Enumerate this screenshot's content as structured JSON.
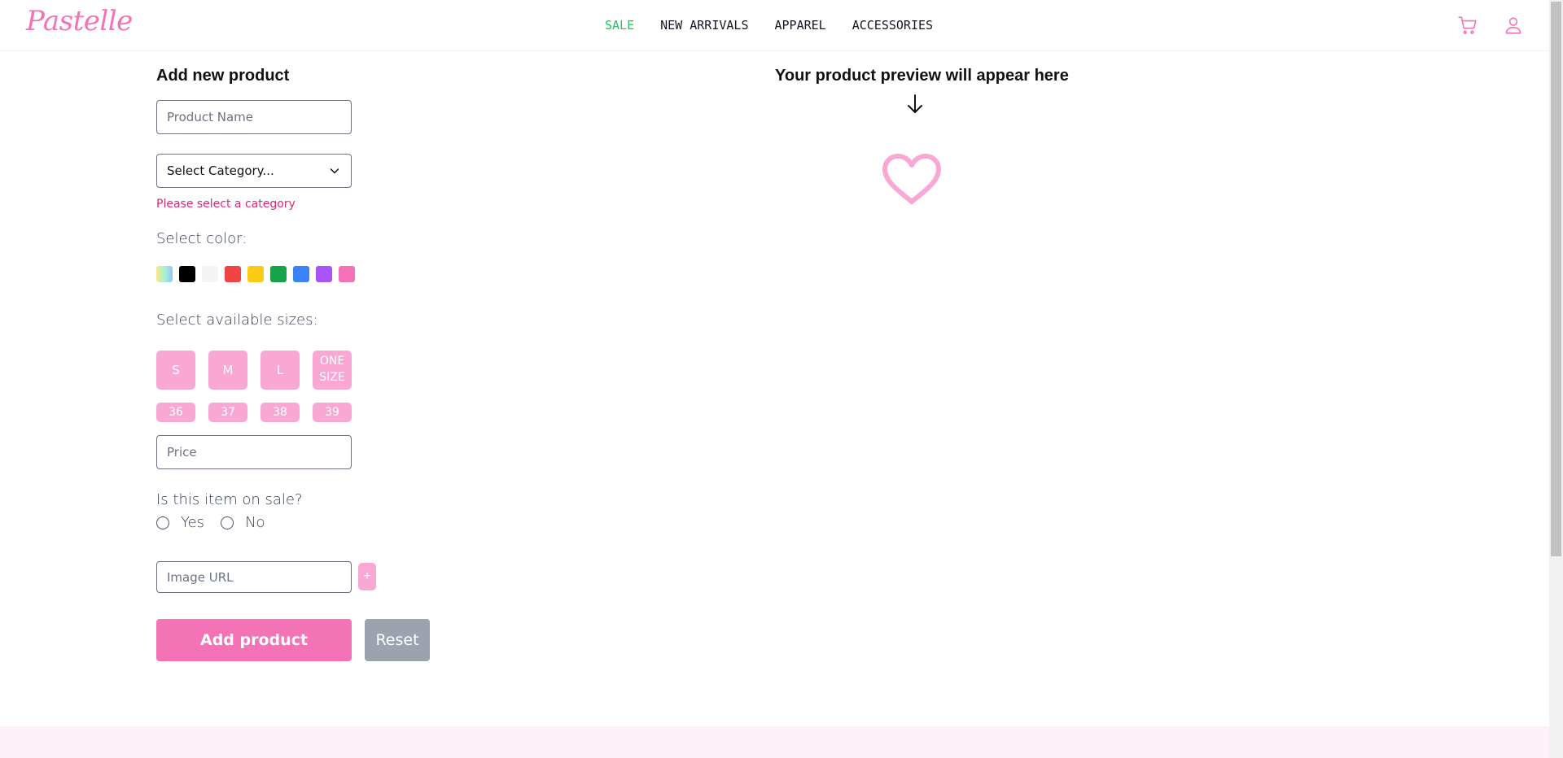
{
  "header": {
    "logo": "Pastelle",
    "nav": [
      "SALE",
      "NEW ARRIVALS",
      "APPAREL",
      "ACCESSORIES"
    ],
    "icons": [
      "cart-icon",
      "user-icon"
    ]
  },
  "form": {
    "title": "Add new product",
    "product_name_placeholder": "Product Name",
    "category_selected": "Select Category...",
    "category_error": "Please select a category",
    "color_label": "Select color:",
    "colors": [
      "multicolor",
      "#000000",
      "#f3f4f6",
      "#ef4444",
      "#facc15",
      "#16a34a",
      "#3b82f6",
      "#a855f7",
      "#f472b6"
    ],
    "sizes_label": "Select available sizes:",
    "sizes": [
      "S",
      "M",
      "L"
    ],
    "one_size_line1": "ONE",
    "one_size_line2": "SIZE",
    "shoe_sizes": [
      "36",
      "37",
      "38",
      "39"
    ],
    "price_placeholder": "Price",
    "sale_question": "Is this item on sale?",
    "sale_yes": "Yes",
    "sale_no": "No",
    "image_url_placeholder": "Image URL",
    "add_image_label": "+",
    "submit_label": "Add product",
    "reset_label": "Reset"
  },
  "preview": {
    "title": "Your product preview will appear here",
    "icons": [
      "arrow-down-icon",
      "heart-icon"
    ]
  },
  "colors": {
    "accent": "#f472b6",
    "accent_light": "#f9a8d4",
    "sale": "#22c55e",
    "error": "#db2777",
    "reset": "#9ca3af"
  }
}
